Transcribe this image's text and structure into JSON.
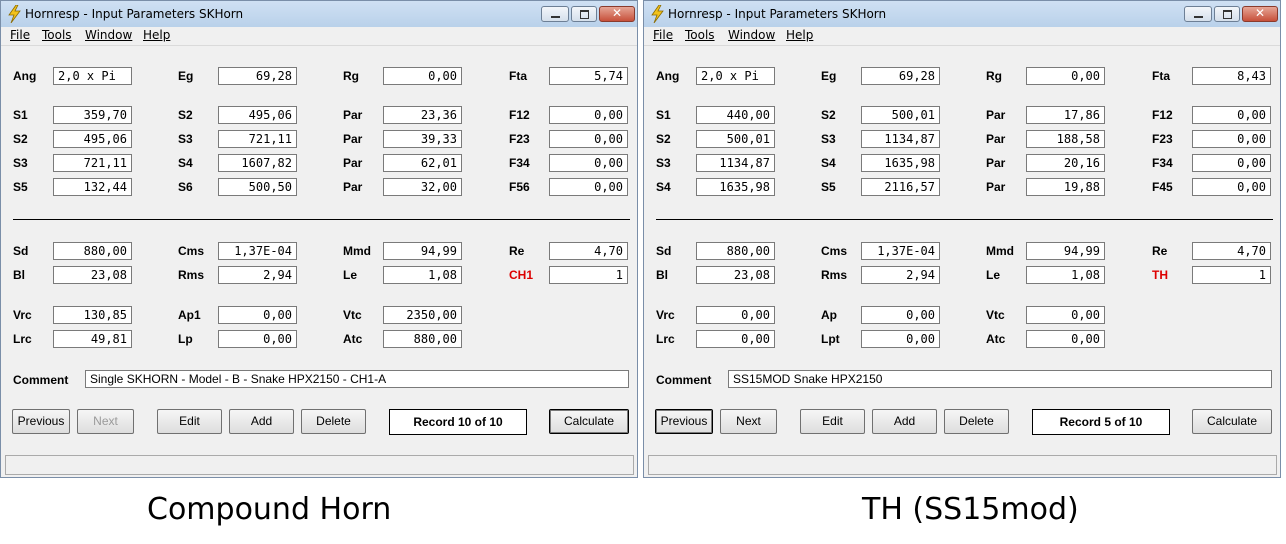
{
  "windows": [
    {
      "title": "Hornresp - Input Parameters   SKHorn",
      "menu": [
        "File",
        "Tools",
        "Window",
        "Help"
      ],
      "rows": [
        [
          [
            "Ang",
            "2,0 x Pi"
          ],
          [
            "Eg",
            "69,28"
          ],
          [
            "Rg",
            "0,00"
          ],
          [
            "Fta",
            "5,74"
          ]
        ],
        [
          [
            "S1",
            "359,70"
          ],
          [
            "S2",
            "495,06"
          ],
          [
            "Par",
            "23,36"
          ],
          [
            "F12",
            "0,00"
          ]
        ],
        [
          [
            "S2",
            "495,06"
          ],
          [
            "S3",
            "721,11"
          ],
          [
            "Par",
            "39,33"
          ],
          [
            "F23",
            "0,00"
          ]
        ],
        [
          [
            "S3",
            "721,11"
          ],
          [
            "S4",
            "1607,82"
          ],
          [
            "Par",
            "62,01"
          ],
          [
            "F34",
            "0,00"
          ]
        ],
        [
          [
            "S5",
            "132,44"
          ],
          [
            "S6",
            "500,50"
          ],
          [
            "Par",
            "32,00"
          ],
          [
            "F56",
            "0,00"
          ]
        ],
        [
          [
            "Sd",
            "880,00"
          ],
          [
            "Cms",
            "1,37E-04"
          ],
          [
            "Mmd",
            "94,99"
          ],
          [
            "Re",
            "4,70"
          ]
        ],
        [
          [
            "Bl",
            "23,08"
          ],
          [
            "Rms",
            "2,94"
          ],
          [
            "Le",
            "1,08"
          ],
          [
            "CH1",
            "1"
          ]
        ],
        [
          [
            "Vrc",
            "130,85"
          ],
          [
            "Ap1",
            "0,00"
          ],
          [
            "Vtc",
            "2350,00"
          ],
          [
            "",
            ""
          ]
        ],
        [
          [
            "Lrc",
            "49,81"
          ],
          [
            "Lp",
            "0,00"
          ],
          [
            "Atc",
            "880,00"
          ],
          [
            "",
            ""
          ]
        ]
      ],
      "red_label": "CH1",
      "comment_label": "Comment",
      "comment": "Single SKHORN - Model - B - Snake HPX2150 - CH1-A",
      "buttons": [
        "Previous",
        "Next",
        "Edit",
        "Add",
        "Delete",
        "Calculate"
      ],
      "record": "Record 10 of 10",
      "next_disabled": true,
      "caption": "Compound Horn"
    },
    {
      "title": "Hornresp - Input Parameters   SKHorn",
      "menu": [
        "File",
        "Tools",
        "Window",
        "Help"
      ],
      "rows": [
        [
          [
            "Ang",
            "2,0 x Pi"
          ],
          [
            "Eg",
            "69,28"
          ],
          [
            "Rg",
            "0,00"
          ],
          [
            "Fta",
            "8,43"
          ]
        ],
        [
          [
            "S1",
            "440,00"
          ],
          [
            "S2",
            "500,01"
          ],
          [
            "Par",
            "17,86"
          ],
          [
            "F12",
            "0,00"
          ]
        ],
        [
          [
            "S2",
            "500,01"
          ],
          [
            "S3",
            "1134,87"
          ],
          [
            "Par",
            "188,58"
          ],
          [
            "F23",
            "0,00"
          ]
        ],
        [
          [
            "S3",
            "1134,87"
          ],
          [
            "S4",
            "1635,98"
          ],
          [
            "Par",
            "20,16"
          ],
          [
            "F34",
            "0,00"
          ]
        ],
        [
          [
            "S4",
            "1635,98"
          ],
          [
            "S5",
            "2116,57"
          ],
          [
            "Par",
            "19,88"
          ],
          [
            "F45",
            "0,00"
          ]
        ],
        [
          [
            "Sd",
            "880,00"
          ],
          [
            "Cms",
            "1,37E-04"
          ],
          [
            "Mmd",
            "94,99"
          ],
          [
            "Re",
            "4,70"
          ]
        ],
        [
          [
            "Bl",
            "23,08"
          ],
          [
            "Rms",
            "2,94"
          ],
          [
            "Le",
            "1,08"
          ],
          [
            "TH",
            "1"
          ]
        ],
        [
          [
            "Vrc",
            "0,00"
          ],
          [
            "Ap",
            "0,00"
          ],
          [
            "Vtc",
            "0,00"
          ],
          [
            "",
            ""
          ]
        ],
        [
          [
            "Lrc",
            "0,00"
          ],
          [
            "Lpt",
            "0,00"
          ],
          [
            "Atc",
            "0,00"
          ],
          [
            "",
            ""
          ]
        ]
      ],
      "red_label": "TH",
      "comment_label": "Comment",
      "comment": "SS15MOD Snake HPX2150",
      "buttons": [
        "Previous",
        "Next",
        "Edit",
        "Add",
        "Delete",
        "Calculate"
      ],
      "record": "Record 5 of 10",
      "next_disabled": false,
      "caption": "TH (SS15mod)"
    }
  ]
}
